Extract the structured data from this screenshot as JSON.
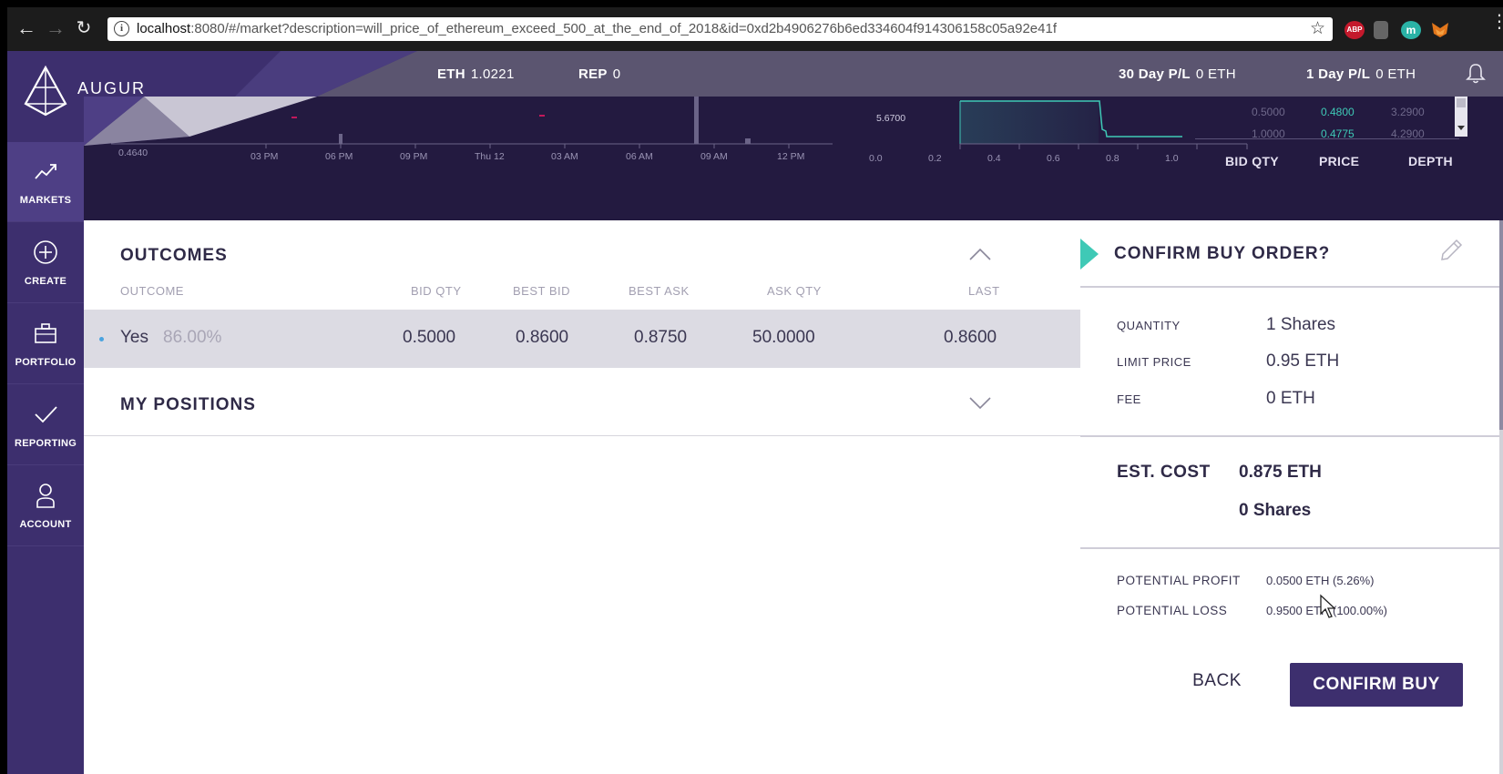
{
  "browser": {
    "url_host": "localhost",
    "url_rest": ":8080/#/market?description=will_price_of_ethereum_exceed_500_at_the_end_of_2018&id=0xd2b4906276b6ed334604f914306158c05a92e41f",
    "extensions": [
      {
        "icon": "abp-icon",
        "label": "ABP",
        "color": "#c4192c"
      },
      {
        "icon": "grey-extension-icon",
        "label": "",
        "color": "#666666"
      },
      {
        "icon": "m-extension-icon",
        "label": "m",
        "color": "#2ab3a6"
      },
      {
        "icon": "metamask-fox-icon",
        "label": "",
        "color": "#e2761b"
      }
    ]
  },
  "header": {
    "brand": "AUGUR",
    "eth_label": "ETH",
    "eth_value": "1.0221",
    "rep_label": "REP",
    "rep_value": "0",
    "pl30_label": "30 Day P/L",
    "pl30_value": "0 ETH",
    "pl1_label": "1 Day P/L",
    "pl1_value": "0 ETH"
  },
  "sidebar": {
    "items": [
      {
        "label": "MARKETS",
        "icon": "trend-icon",
        "active": true
      },
      {
        "label": "CREATE",
        "icon": "plus-circle-icon",
        "active": false
      },
      {
        "label": "PORTFOLIO",
        "icon": "briefcase-icon",
        "active": false
      },
      {
        "label": "REPORTING",
        "icon": "checkmark-icon",
        "active": false
      },
      {
        "label": "ACCOUNT",
        "icon": "user-icon",
        "active": false
      }
    ]
  },
  "charts": {
    "price_history": {
      "y_label": "0.4640",
      "x_ticks": [
        "03 PM",
        "06 PM",
        "09 PM",
        "Thu 12",
        "03 AM",
        "06 AM",
        "09 AM",
        "12 PM"
      ]
    },
    "depth_chart": {
      "marker_label": "5.6700",
      "x_ticks": [
        "0.0",
        "0.2",
        "0.4",
        "0.6",
        "0.8",
        "1.0"
      ],
      "colors": {
        "bid": "#3fc9b6",
        "marker": "#c2185b"
      }
    },
    "order_book": {
      "rows": [
        {
          "qty": "0.5000",
          "price": "0.4800",
          "depth": "3.2900"
        },
        {
          "qty": "1.0000",
          "price": "0.4775",
          "depth": "4.2900"
        }
      ],
      "headers": {
        "qty": "BID QTY",
        "price": "PRICE",
        "depth": "DEPTH"
      }
    }
  },
  "outcomes": {
    "title": "OUTCOMES",
    "columns": {
      "outcome": "OUTCOME",
      "bid_qty": "BID QTY",
      "best_bid": "BEST BID",
      "best_ask": "BEST ASK",
      "ask_qty": "ASK QTY",
      "last": "LAST"
    },
    "rows": [
      {
        "name": "Yes",
        "percent": "86.00%",
        "bid_qty": "0.5000",
        "best_bid": "0.8600",
        "best_ask": "0.8750",
        "ask_qty": "50.0000",
        "last": "0.8600"
      }
    ]
  },
  "positions": {
    "title": "MY POSITIONS"
  },
  "confirm": {
    "title": "CONFIRM BUY ORDER?",
    "quantity_label": "QUANTITY",
    "quantity_value": "1 Shares",
    "limit_label": "LIMIT PRICE",
    "limit_value": "0.95 ETH",
    "fee_label": "FEE",
    "fee_value": "0 ETH",
    "est_label": "EST. COST",
    "est_eth": "0.875 ETH",
    "est_shares": "0 Shares",
    "profit_label": "POTENTIAL PROFIT",
    "profit_value": "0.0500 ETH (5.26%)",
    "loss_label": "POTENTIAL LOSS",
    "loss_value": "0.9500 ETH (100.00%)",
    "back_label": "BACK",
    "confirm_label": "CONFIRM BUY",
    "accent_color": "#3fc9b6"
  }
}
